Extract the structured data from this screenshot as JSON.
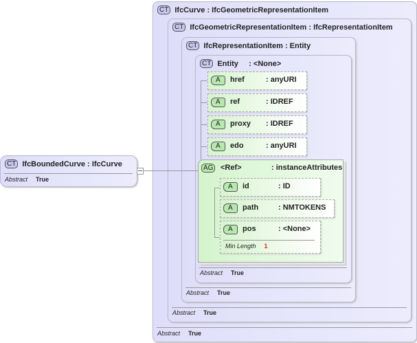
{
  "root": {
    "badge": "CT",
    "name": "IfcBoundedCurve",
    "base": ": IfcCurve",
    "abstract_label": "Abstract",
    "abstract_value": "True"
  },
  "levels": [
    {
      "badge": "CT",
      "name": "IfcCurve",
      "base": ": IfcGeometricRepresentationItem",
      "abstract_label": "Abstract",
      "abstract_value": "True"
    },
    {
      "badge": "CT",
      "name": "IfcGeometricRepresentationItem",
      "base": ": IfcRepresentationItem",
      "abstract_label": "Abstract",
      "abstract_value": "True"
    },
    {
      "badge": "CT",
      "name": "IfcRepresentationItem",
      "base": ": Entity",
      "abstract_label": "Abstract",
      "abstract_value": "True"
    },
    {
      "badge": "CT",
      "name": "Entity",
      "base": ": <None>",
      "abstract_label": "Abstract",
      "abstract_value": "True"
    }
  ],
  "attributes": [
    {
      "badge": "A",
      "name": "href",
      "type": ": anyURI"
    },
    {
      "badge": "A",
      "name": "ref",
      "type": ": IDREF"
    },
    {
      "badge": "A",
      "name": "proxy",
      "type": ": IDREF"
    },
    {
      "badge": "A",
      "name": "edo",
      "type": ": anyURI"
    }
  ],
  "group": {
    "badge": "AG",
    "name": "<Ref>",
    "type": ": instanceAttributes",
    "attributes": [
      {
        "badge": "A",
        "name": "id",
        "type": ": ID"
      },
      {
        "badge": "A",
        "name": "path",
        "type": ": NMTOKENS"
      },
      {
        "badge": "A",
        "name": "pos",
        "type": ": <None>",
        "facet_label": "Min Length",
        "facet_value": "1"
      }
    ]
  },
  "colors": {
    "facet_value": "#e02020"
  }
}
